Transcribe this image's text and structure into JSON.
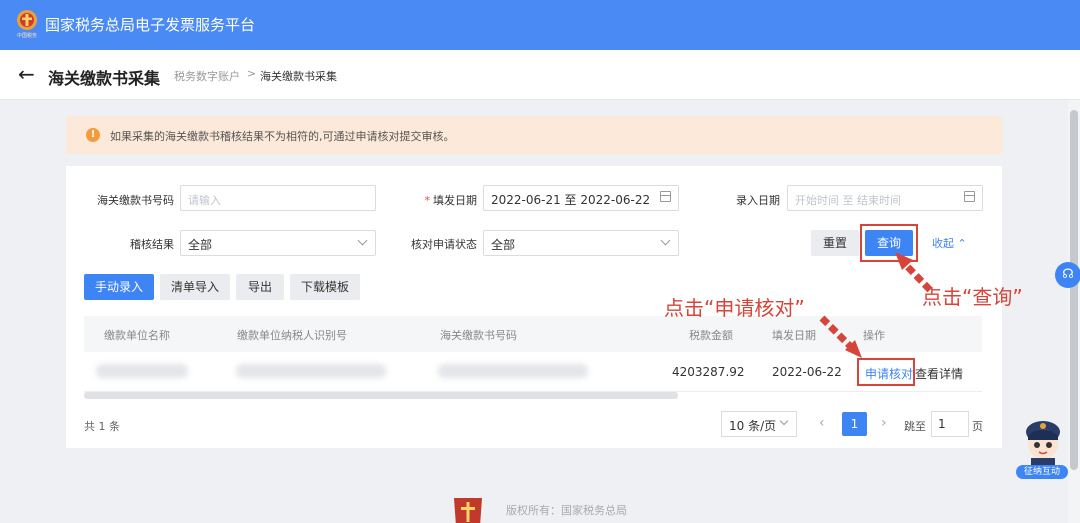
{
  "header": {
    "platform_title": "国家税务总局电子发票服务平台",
    "logo_caption": "中国税务"
  },
  "page": {
    "back_icon": "arrow-left-icon",
    "title": "海关缴款书采集",
    "breadcrumb": [
      "税务数字账户",
      "海关缴款书采集"
    ],
    "breadcrumb_sep": ">"
  },
  "alert": {
    "icon": "warning-icon",
    "text": "如果采集的海关缴款书稽核结果不为相符的,可通过申请核对提交审核。"
  },
  "filters": {
    "customs_no_label": "海关缴款书号码",
    "customs_no_placeholder": "请输入",
    "issue_date_label": "填发日期",
    "issue_date_value": "2022-06-21 至 2022-06-22",
    "entry_date_label": "录入日期",
    "entry_date_placeholder": "开始时间 至 结束时间",
    "audit_result_label": "稽核结果",
    "audit_result_value": "全部",
    "verify_status_label": "核对申请状态",
    "verify_status_value": "全部",
    "reset_label": "重置",
    "query_label": "查询",
    "collapse_label": "收起"
  },
  "toolbar": {
    "manual_entry": "手动录入",
    "list_import": "清单导入",
    "export": "导出",
    "download_template": "下载模板"
  },
  "table": {
    "columns": [
      "缴款单位名称",
      "缴款单位纳税人识别号",
      "海关缴款书号码",
      "税款金额",
      "填发日期",
      "操作"
    ],
    "rows": [
      {
        "amount": "4203287.92",
        "issue_date": "2022-06-22",
        "action_verify": "申请核对",
        "action_detail": "查看详情"
      }
    ]
  },
  "pagination": {
    "total": "共 1 条",
    "page_size": "10 条/页",
    "current_page": "1",
    "jump_label": "跳至",
    "jump_value": "1",
    "page_unit": "页"
  },
  "annotations": {
    "query_hint": "点击“查询”",
    "verify_hint": "点击“申请核对”"
  },
  "assistant": {
    "label": "征纳互动"
  },
  "footer": {
    "copyright": "版权所有：国家税务总局",
    "line2": ""
  },
  "colors": {
    "header_blue": "#4a8af4",
    "primary": "#3d84f4",
    "annotation_red": "#d7443a",
    "alert_bg": "#fde9d9"
  }
}
